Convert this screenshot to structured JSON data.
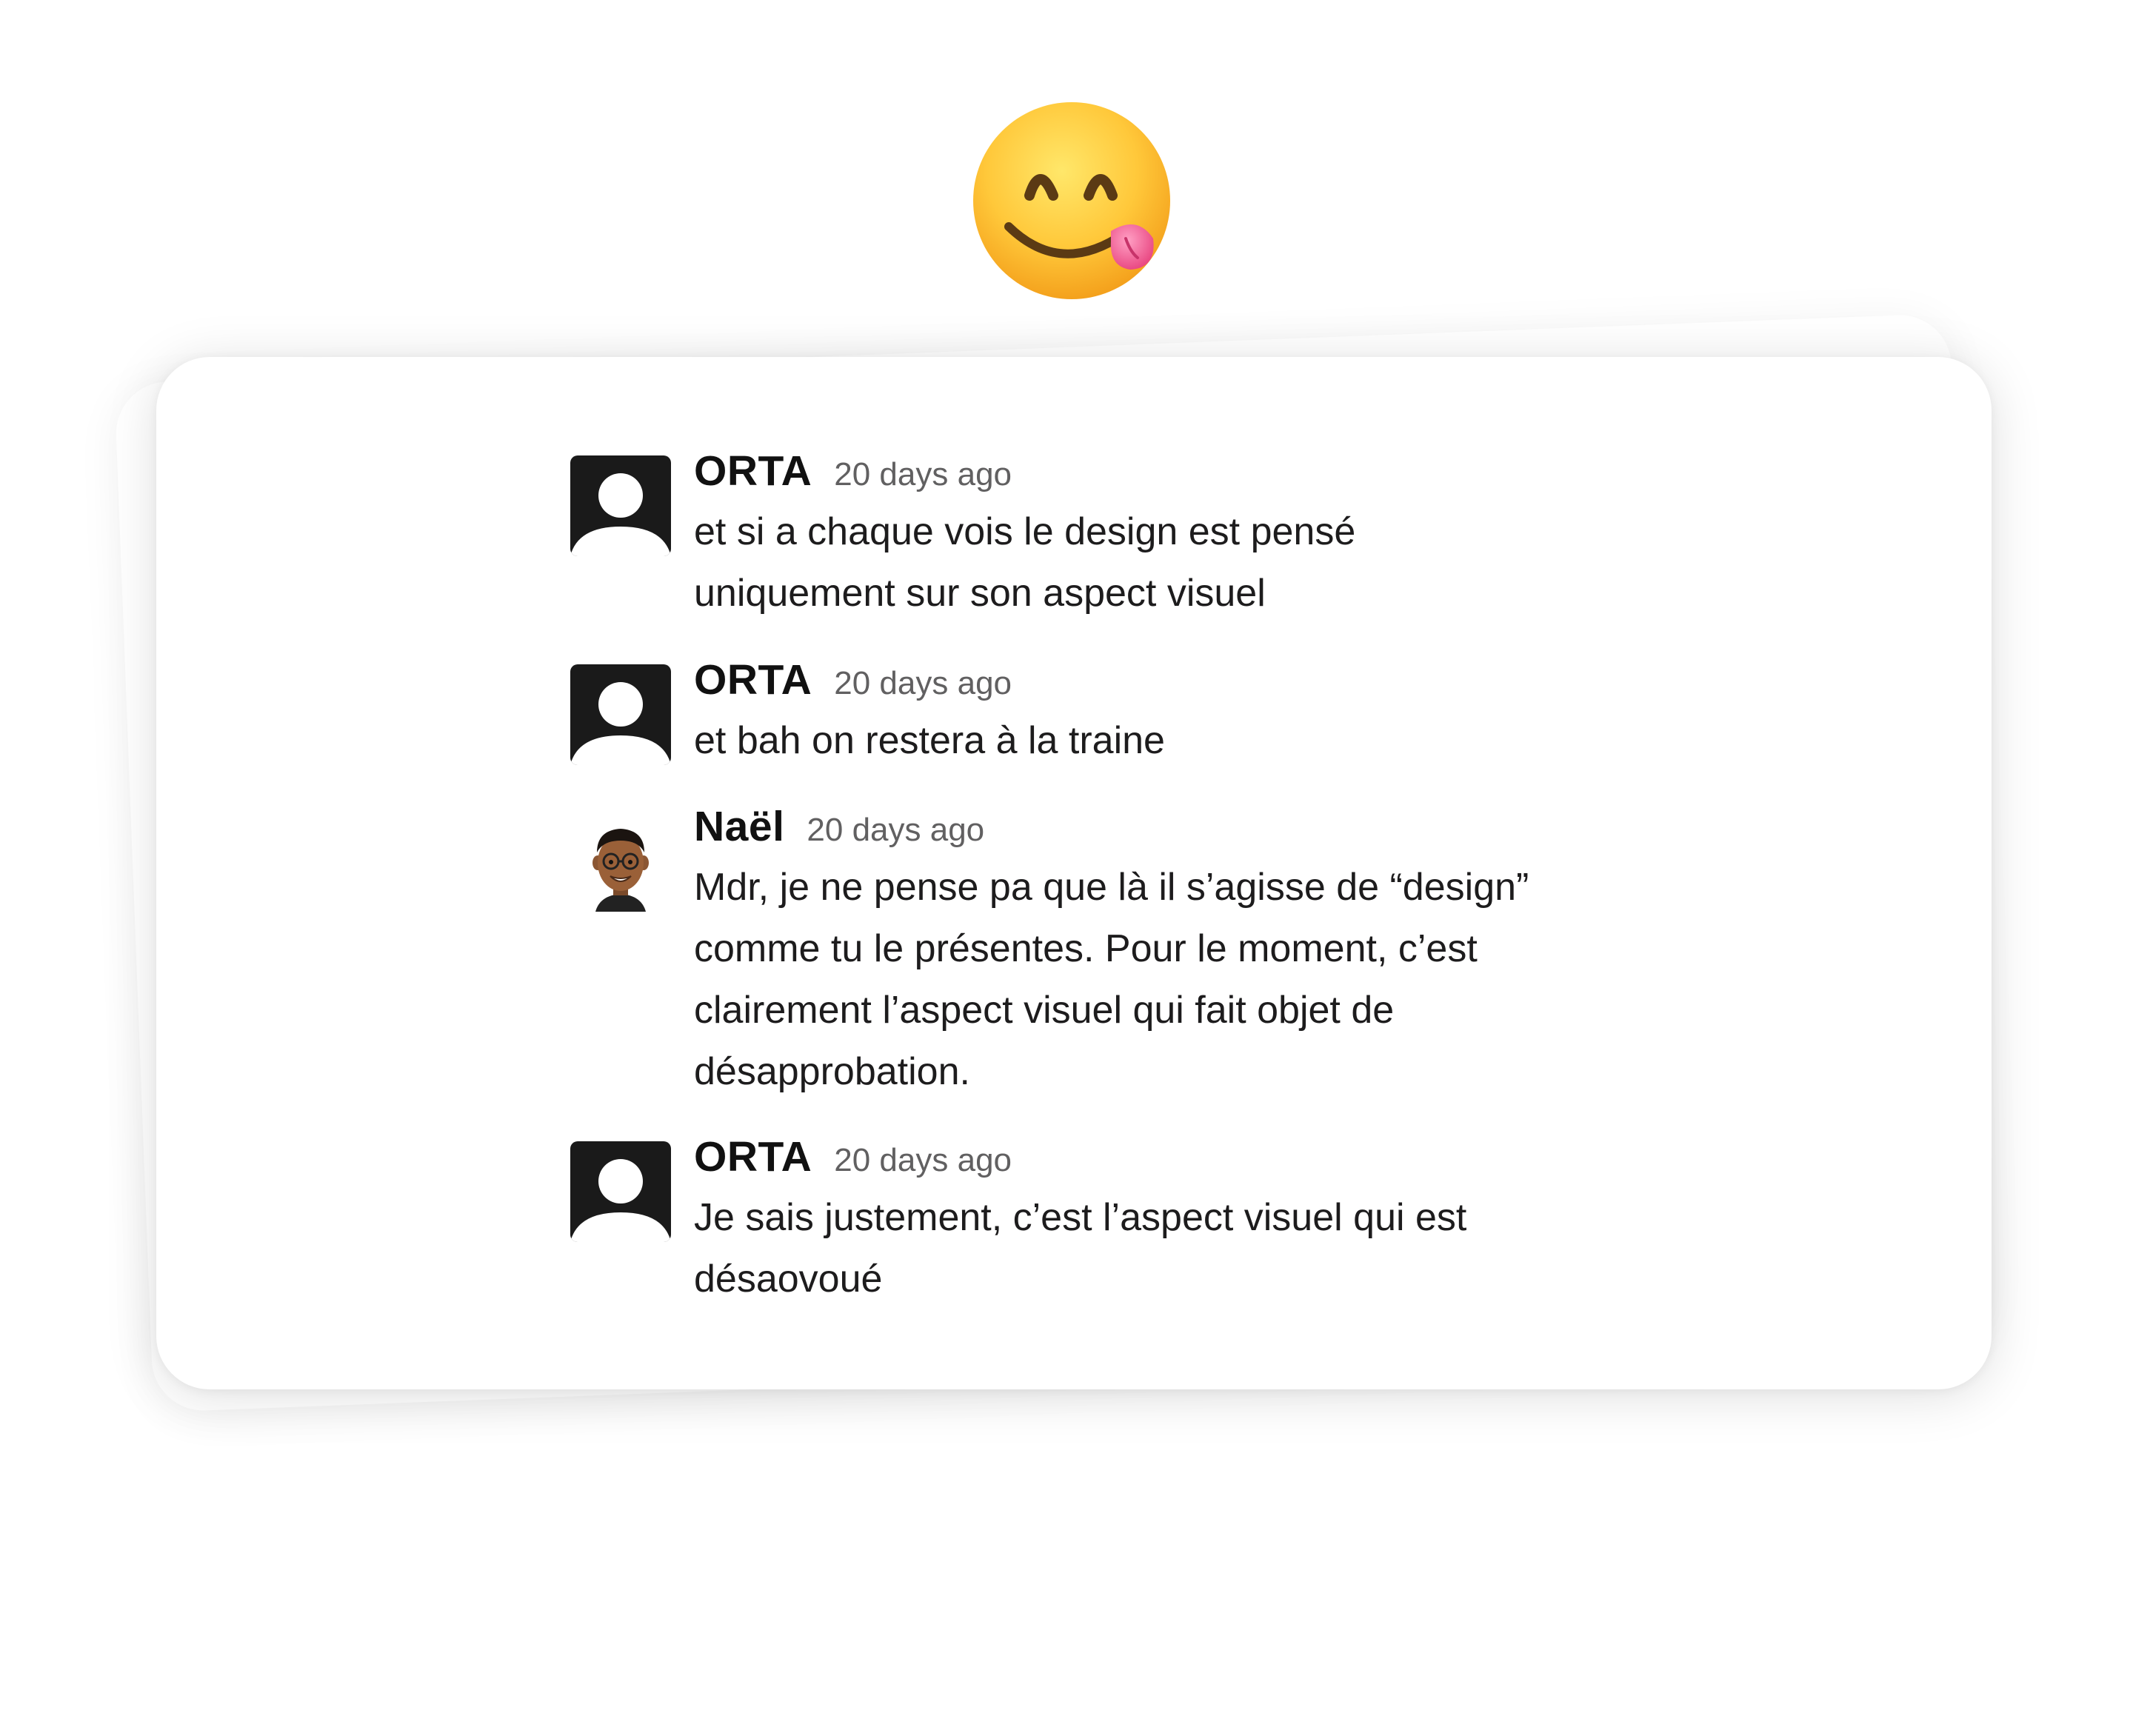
{
  "hero": {
    "icon": "face-savoring-food-emoji"
  },
  "messages": [
    {
      "author": "ORTA",
      "timestamp": "20 days ago",
      "avatar": "default-user-avatar",
      "text": "et si a chaque vois le design est pensé\nuniquement sur son aspect visuel"
    },
    {
      "author": "ORTA",
      "timestamp": "20 days ago",
      "avatar": "default-user-avatar",
      "text": "et bah on restera à la traine"
    },
    {
      "author": "Naël",
      "timestamp": "20 days ago",
      "avatar": "bitmoji-avatar",
      "text": "Mdr, je ne pense pa que là il s’agisse de “design”\ncomme tu le présentes. Pour le moment, c’est\nclairement l’aspect visuel qui fait objet de\ndésapprobation."
    },
    {
      "author": "ORTA",
      "timestamp": "20 days ago",
      "avatar": "default-user-avatar",
      "text": "Je sais justement, c’est l’aspect visuel qui est\ndésaovoué"
    }
  ],
  "colors": {
    "author": "#111111",
    "timestamp": "#616061",
    "text": "#1d1c1d",
    "avatar_bg": "#1a1a1a",
    "card_bg": "#ffffff"
  }
}
